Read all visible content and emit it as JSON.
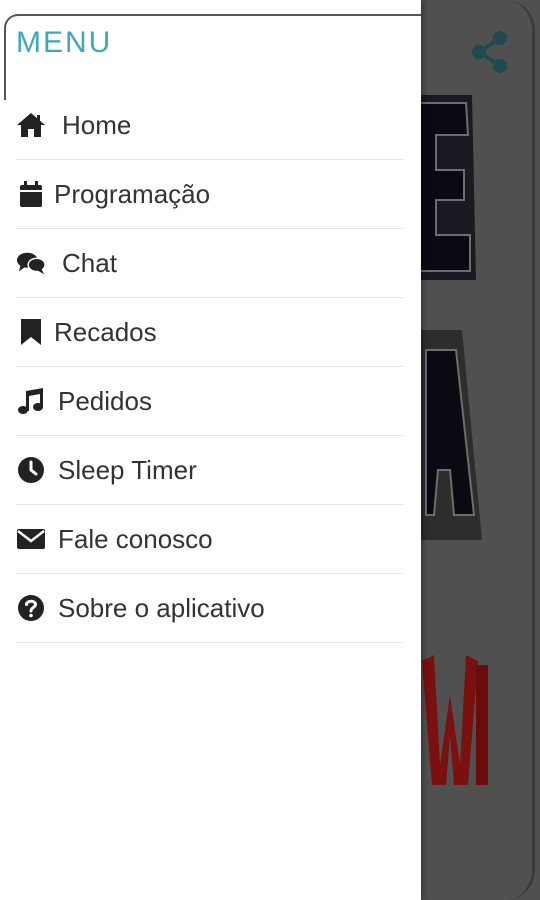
{
  "drawer": {
    "title": "MENU",
    "items": [
      {
        "label": "Home",
        "icon": "home-icon"
      },
      {
        "label": "Programação",
        "icon": "calendar-icon"
      },
      {
        "label": "Chat",
        "icon": "chat-icon"
      },
      {
        "label": "Recados",
        "icon": "bookmark-icon"
      },
      {
        "label": "Pedidos",
        "icon": "music-note-icon"
      },
      {
        "label": "Sleep Timer",
        "icon": "clock-icon"
      },
      {
        "label": "Fale conosco",
        "icon": "envelope-icon"
      },
      {
        "label": "Sobre o aplicativo",
        "icon": "question-circle-icon"
      }
    ]
  },
  "background": {
    "share_icon": "share-icon",
    "accent_color": "#40a6b8",
    "logo_letters": [
      "E",
      "A",
      "WEB"
    ]
  }
}
